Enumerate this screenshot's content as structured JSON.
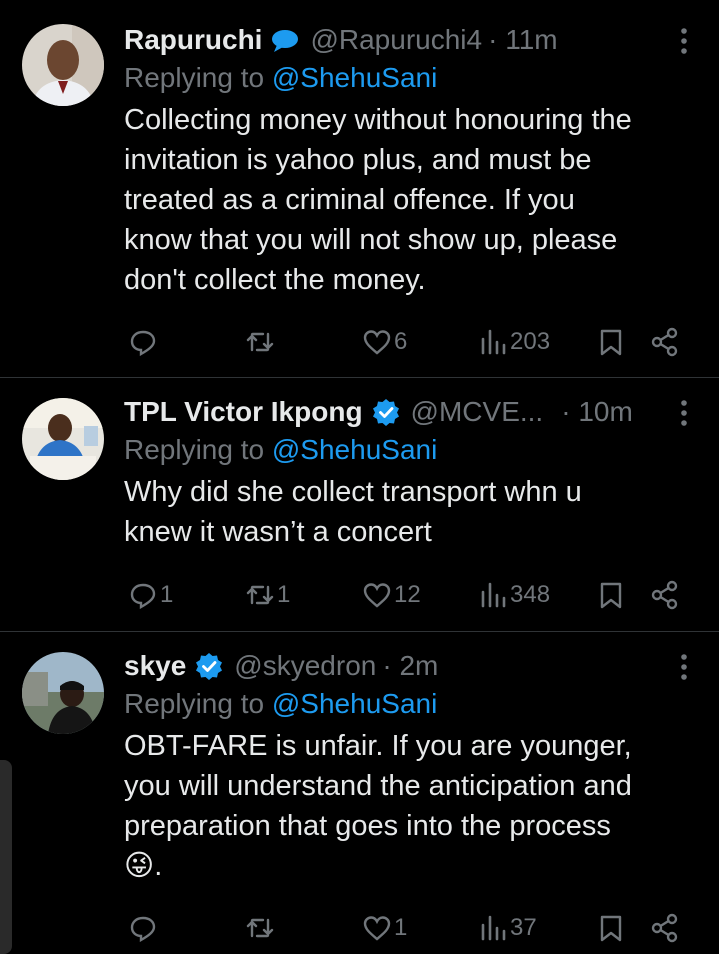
{
  "tweets": [
    {
      "name": "Rapuruchi",
      "badge": "speech-bubble",
      "handle": "@Rapuruchi4",
      "time": "· 11m",
      "replying_prefix": "Replying to ",
      "replying_to": "@ShehuSani",
      "text_lines": [
        "Collecting money without honouring the",
        "invitation is yahoo plus, and must be",
        "treated as a criminal offence. If you",
        "know that you will not show up, please",
        "don't collect the money."
      ],
      "stats": {
        "replies": "",
        "reposts": "",
        "likes": "6",
        "views": "203"
      }
    },
    {
      "name": "TPL Victor Ikpong",
      "badge": "verified",
      "handle": "@MCVE...",
      "time": "· 10m",
      "replying_prefix": "Replying to ",
      "replying_to": "@ShehuSani",
      "text_lines": [
        "Why did she collect transport whn u",
        "knew it wasn’t a concert"
      ],
      "stats": {
        "replies": "1",
        "reposts": "1",
        "likes": "12",
        "views": "348"
      }
    },
    {
      "name": "skye",
      "badge": "verified",
      "handle": "@skyedron",
      "time": "· 2m",
      "replying_prefix": "Replying to ",
      "replying_to": "@ShehuSani",
      "text_lines": [
        "OBT-FARE is unfair. If you are younger,",
        "you will understand the anticipation and",
        "preparation that goes into the process",
        "😜."
      ],
      "stats": {
        "replies": "",
        "reposts": "",
        "likes": "1",
        "views": "37"
      }
    }
  ],
  "colors": {
    "accent": "#1d9bf0",
    "muted": "#71767b",
    "text": "#e7e9ea",
    "bg": "#000000"
  },
  "icons": [
    "reply-icon",
    "repost-icon",
    "like-icon",
    "views-icon",
    "bookmark-icon",
    "share-icon",
    "more-icon"
  ]
}
